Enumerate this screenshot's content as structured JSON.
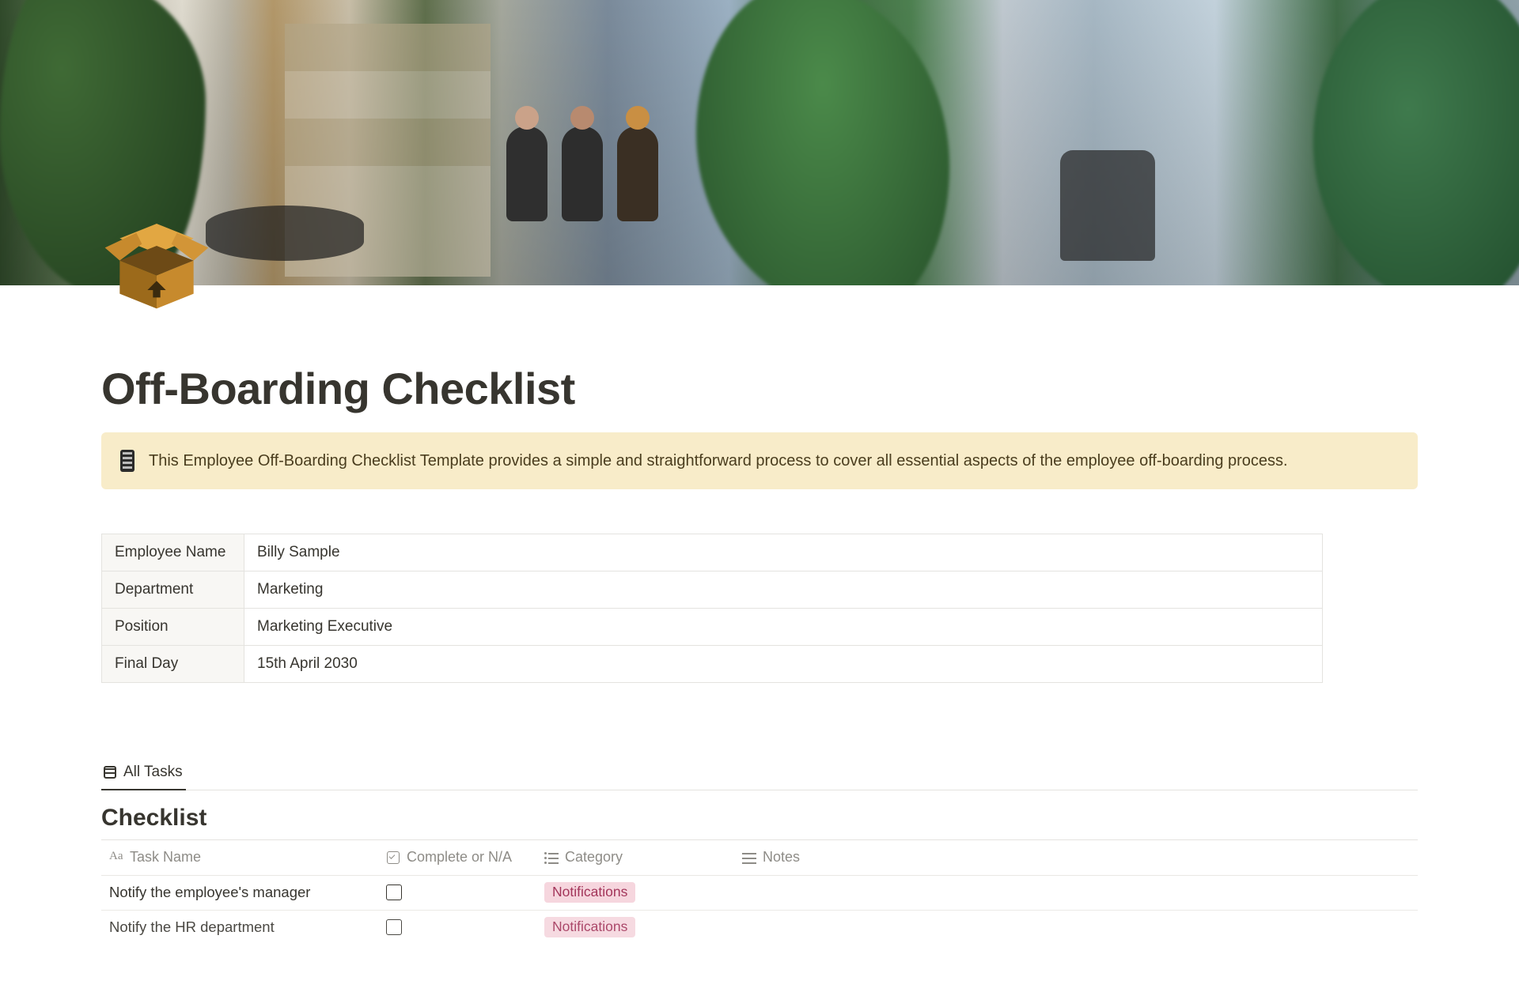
{
  "page": {
    "title": "Off-Boarding Checklist"
  },
  "callout": {
    "text": "This Employee Off-Boarding Checklist Template provides a simple and straightforward process to cover all essential aspects of the employee off-boarding process."
  },
  "employee": {
    "rows": [
      {
        "label": "Employee Name",
        "value": "Billy Sample"
      },
      {
        "label": "Department",
        "value": "Marketing"
      },
      {
        "label": "Position",
        "value": "Marketing Executive"
      },
      {
        "label": "Final Day",
        "value": "15th April 2030"
      }
    ]
  },
  "database": {
    "tab_label": "All Tasks",
    "title": "Checklist",
    "columns": {
      "task": "Task Name",
      "complete": "Complete or N/A",
      "category": "Category",
      "notes": "Notes"
    },
    "rows": [
      {
        "task": "Notify the employee's manager",
        "complete": false,
        "category": "Notifications",
        "notes": ""
      },
      {
        "task": "Notify the HR department",
        "complete": false,
        "category": "Notifications",
        "notes": ""
      }
    ],
    "tag_color": "#f6d6de"
  }
}
